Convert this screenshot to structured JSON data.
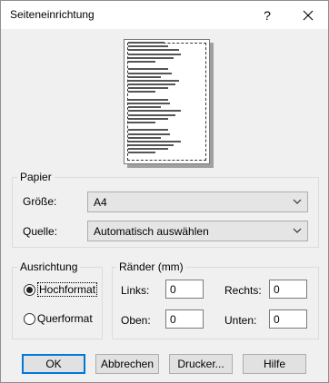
{
  "window": {
    "title": "Seiteneinrichtung",
    "help_glyph": "?",
    "close_glyph": "✕"
  },
  "paper": {
    "group_label": "Papier",
    "size_label": "Größe:",
    "size_value": "A4",
    "source_label": "Quelle:",
    "source_value": "Automatisch auswählen"
  },
  "orientation": {
    "group_label": "Ausrichtung",
    "portrait_label": "Hochformat",
    "landscape_label": "Querformat",
    "selected": "portrait"
  },
  "margins": {
    "group_label": "Ränder (mm)",
    "left_label": "Links:",
    "left_value": "0",
    "right_label": "Rechts:",
    "right_value": "0",
    "top_label": "Oben:",
    "top_value": "0",
    "bottom_label": "Unten:",
    "bottom_value": "0"
  },
  "buttons": {
    "ok": "OK",
    "cancel": "Abbrechen",
    "printer": "Drucker...",
    "help": "Hilfe"
  },
  "colors": {
    "dialog_bg": "#f0f0f0",
    "default_button_border": "#0078d7"
  }
}
